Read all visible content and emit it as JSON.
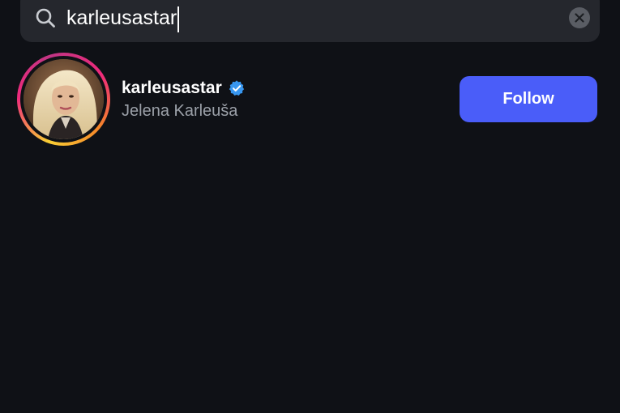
{
  "search": {
    "query": "karleusastar",
    "icon": "search-icon",
    "clear_icon": "close-icon"
  },
  "result": {
    "username": "karleusastar",
    "verified": true,
    "full_name": "Jelena Karleuša",
    "follow_label": "Follow"
  },
  "colors": {
    "background": "#0f1116",
    "search_bg": "#25272d",
    "follow_button": "#4a5df9",
    "verified_badge": "#3897f0",
    "secondary_text": "#9ba0a8"
  }
}
